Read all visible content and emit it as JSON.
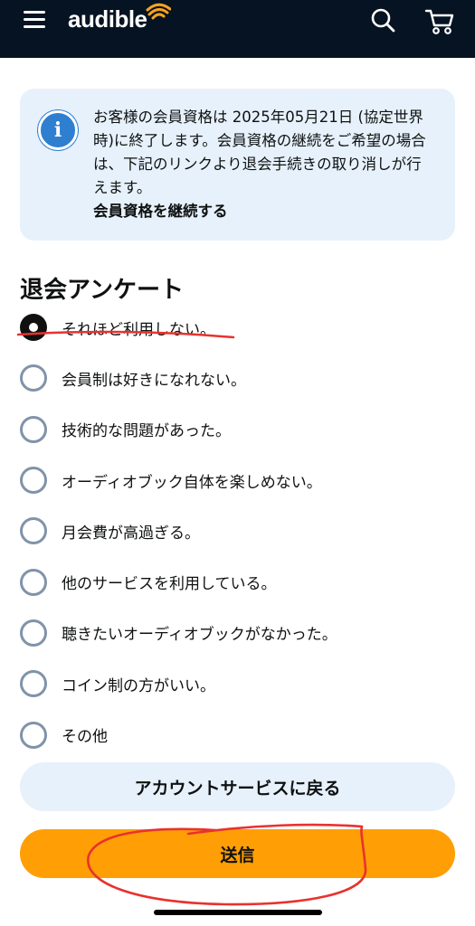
{
  "header": {
    "logo_text": "audible",
    "icons": [
      "menu-icon",
      "search-icon",
      "cart-icon"
    ],
    "background_color": "#061322",
    "logo_accent_color": "#f7a41d"
  },
  "notice": {
    "text": "お客様の会員資格は 2025年05月21日 (協定世界時)に終了します。会員資格の継続をご希望の場合は、下記のリンクより退会手続きの取り消しが行えます。",
    "link_label": "会員資格を継続する",
    "icon": "info-icon",
    "background_color": "#e6f1fb"
  },
  "survey": {
    "title": "退会アンケート",
    "selected_index": 0,
    "options": [
      {
        "label": "それほど利用しない。"
      },
      {
        "label": "会員制は好きになれない。"
      },
      {
        "label": "技術的な問題があった。"
      },
      {
        "label": "オーディオブック自体を楽しめない。"
      },
      {
        "label": "月会費が高過ぎる。"
      },
      {
        "label": "他のサービスを利用している。"
      },
      {
        "label": "聴きたいオーディオブックがなかった。"
      },
      {
        "label": "コイン制の方がいい。"
      },
      {
        "label": "その他"
      }
    ]
  },
  "actions": {
    "back_label": "アカウントサービスに戻る",
    "submit_label": "送信",
    "submit_color": "#ff9f05"
  },
  "annotations": {
    "color": "#e8322e"
  }
}
